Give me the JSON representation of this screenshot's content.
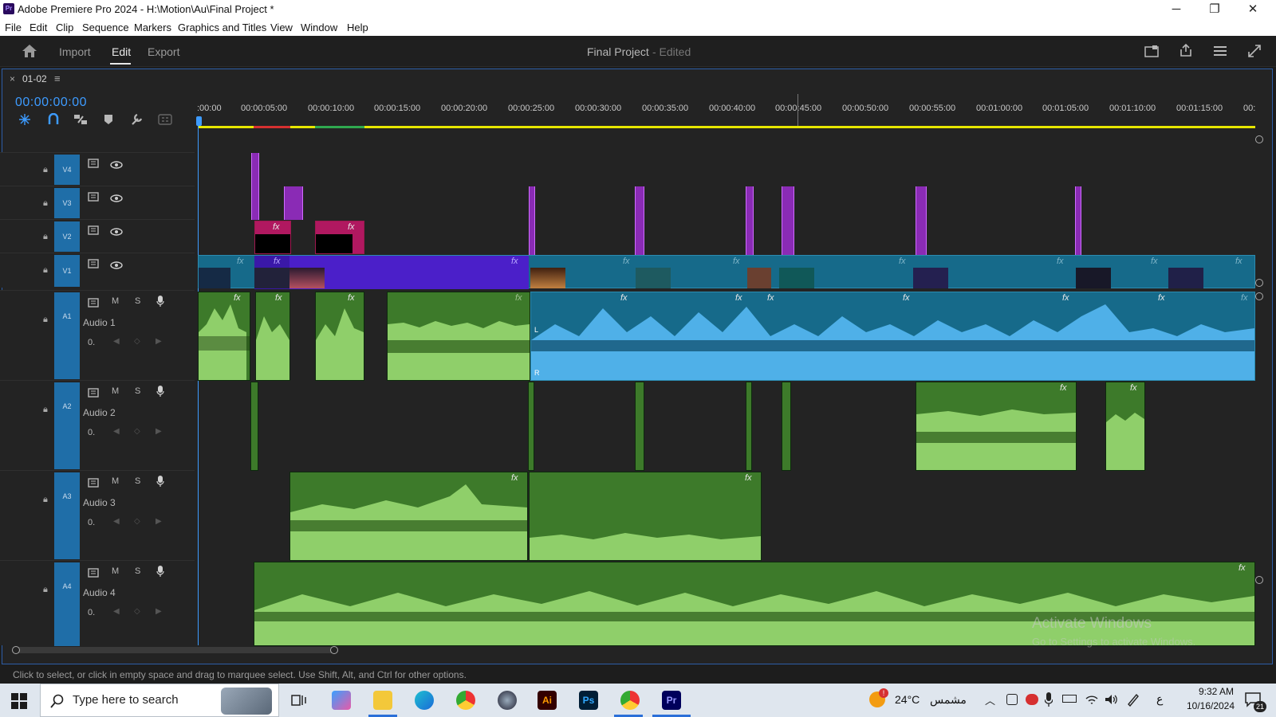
{
  "window": {
    "title": "Adobe Premiere Pro 2024 - H:\\Motion\\Au\\Final Project *",
    "app_icon": "Pr",
    "controls": [
      "─",
      "❐",
      "✕"
    ]
  },
  "menu": [
    "File",
    "Edit",
    "Clip",
    "Sequence",
    "Markers",
    "Graphics and Titles",
    "View",
    "Window",
    "Help"
  ],
  "header": {
    "tabs": [
      "Import",
      "Edit",
      "Export"
    ],
    "active_tab": "Edit",
    "project_name": "Final Project",
    "project_state": "- Edited"
  },
  "timeline": {
    "sequence_tab": "01-02",
    "timecode": "00:00:00:00",
    "ruler_labels": [
      ":00:00",
      "00:00:05:00",
      "00:00:10:00",
      "00:00:15:00",
      "00:00:20:00",
      "00:00:25:00",
      "00:00:30:00",
      "00:00:35:00",
      "00:00:40:00",
      "00:00:45:00",
      "00:00:50:00",
      "00:00:55:00",
      "00:01:00:00",
      "00:01:05:00",
      "00:01:10:00",
      "00:01:15:00",
      "00:"
    ],
    "video_tracks": [
      "V4",
      "V3",
      "V2",
      "V1"
    ],
    "audio_tracks": [
      {
        "id": "A1",
        "name": "Audio 1"
      },
      {
        "id": "A2",
        "name": "Audio 2"
      },
      {
        "id": "A3",
        "name": "Audio 3"
      },
      {
        "id": "A4",
        "name": "Audio 4"
      }
    ],
    "track_button_labels": {
      "mute": "M",
      "solo": "S",
      "volume": "0."
    },
    "fx_label": "fx",
    "channel_labels": {
      "left": "L",
      "right": "R"
    }
  },
  "watermark": {
    "line1": "Activate Windows",
    "line2": "Go to Settings to activate Windows."
  },
  "status_text": "Click to select, or click in empty space and drag to marquee select. Use Shift, Alt, and Ctrl for other options.",
  "taskbar": {
    "search_placeholder": "Type here to search",
    "weather": "24°C",
    "weather_desc": "مشمس",
    "weather_badge": "!",
    "time": "9:32 AM",
    "date": "10/16/2024",
    "lang": "ع",
    "notif_count": "21",
    "apps": [
      "Ai",
      "Ps",
      "Pr"
    ]
  }
}
